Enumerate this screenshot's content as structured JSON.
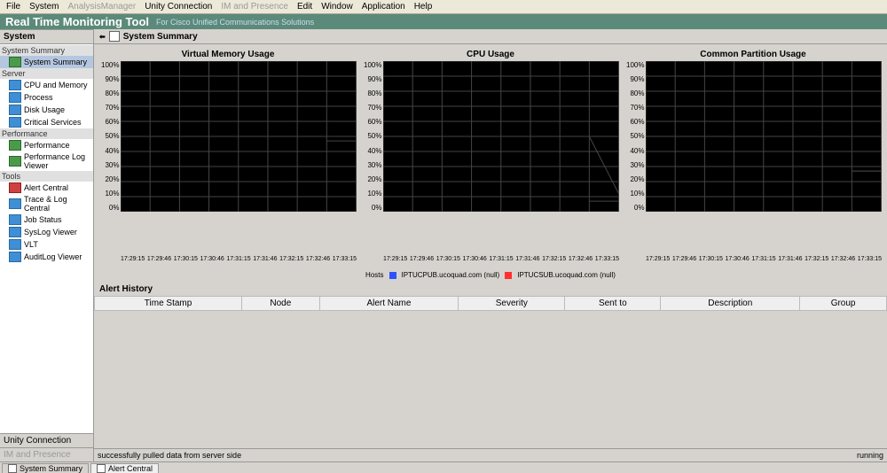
{
  "menu": {
    "items": [
      "File",
      "System",
      "AnalysisManager",
      "Unity Connection",
      "IM and Presence",
      "Edit",
      "Window",
      "Application",
      "Help"
    ],
    "dim": [
      2,
      4
    ]
  },
  "title": {
    "main": "Real Time Monitoring Tool",
    "sub": "For Cisco Unified Communications Solutions"
  },
  "sidebar": {
    "head": "System",
    "cats": [
      {
        "label": "System Summary",
        "items": [
          {
            "label": "System Summary",
            "sel": true,
            "ic": "g"
          }
        ]
      },
      {
        "label": "Server",
        "items": [
          {
            "label": "CPU and Memory",
            "ic": "b"
          },
          {
            "label": "Process",
            "ic": "b"
          },
          {
            "label": "Disk Usage",
            "ic": "b"
          },
          {
            "label": "Critical Services",
            "ic": "b"
          }
        ]
      },
      {
        "label": "Performance",
        "items": [
          {
            "label": "Performance",
            "ic": "g"
          },
          {
            "label": "Performance Log Viewer",
            "ic": "g"
          }
        ]
      },
      {
        "label": "Tools",
        "items": [
          {
            "label": "Alert Central",
            "ic": "r"
          },
          {
            "label": "Trace & Log Central",
            "ic": "b"
          },
          {
            "label": "Job Status",
            "ic": "b"
          },
          {
            "label": "SysLog Viewer",
            "ic": "b"
          },
          {
            "label": "VLT",
            "ic": "b"
          },
          {
            "label": "AuditLog Viewer",
            "ic": "b"
          }
        ]
      }
    ],
    "foot1": "Unity Connection",
    "foot2": "IM and Presence"
  },
  "panel_title": "System Summary",
  "yticks": [
    "100%",
    "90%",
    "80%",
    "70%",
    "60%",
    "50%",
    "40%",
    "30%",
    "20%",
    "10%",
    "0%"
  ],
  "xticks": [
    "17:29:15",
    "17:29:46",
    "17:30:15",
    "17:30:46",
    "17:31:15",
    "17:31:46",
    "17:32:15",
    "17:32:46",
    "17:33:15"
  ],
  "legend": {
    "label": "Hosts",
    "items": [
      {
        "name": "IPTUCPUB.ucoquad.com (null)",
        "color": "#3050ff"
      },
      {
        "name": "IPTUCSUB.ucoquad.com (null)",
        "color": "#ff3030"
      }
    ]
  },
  "alert": {
    "title": "Alert History",
    "cols": [
      "Time Stamp",
      "Node",
      "Alert Name",
      "Severity",
      "Sent to",
      "Description",
      "Group"
    ]
  },
  "status": {
    "left": "successfully pulled data from server side",
    "right": "running"
  },
  "tabs": [
    {
      "label": "System Summary",
      "sel": true
    },
    {
      "label": "Alert Central",
      "sel": false
    }
  ],
  "chart_data": [
    {
      "type": "line",
      "title": "Virtual Memory Usage",
      "ylim": [
        0,
        100
      ],
      "ylabel": "%",
      "x": [
        "17:29:15",
        "17:29:46",
        "17:30:15",
        "17:30:46",
        "17:31:15",
        "17:31:46",
        "17:32:15",
        "17:32:46",
        "17:33:15"
      ],
      "series": [
        {
          "name": "IPTUCPUB",
          "color": "#3050ff",
          "values": [
            null,
            null,
            null,
            null,
            null,
            null,
            null,
            50,
            50
          ]
        },
        {
          "name": "IPTUCSUB",
          "color": "#ff3030",
          "values": [
            null,
            null,
            null,
            null,
            null,
            null,
            null,
            47,
            47
          ]
        }
      ]
    },
    {
      "type": "line",
      "title": "CPU Usage",
      "ylim": [
        0,
        100
      ],
      "ylabel": "%",
      "x": [
        "17:29:15",
        "17:29:46",
        "17:30:15",
        "17:30:46",
        "17:31:15",
        "17:31:46",
        "17:32:15",
        "17:32:46",
        "17:33:15"
      ],
      "series": [
        {
          "name": "IPTUCPUB",
          "color": "#3050ff",
          "values": [
            null,
            null,
            null,
            null,
            null,
            null,
            null,
            50,
            12
          ]
        },
        {
          "name": "IPTUCSUB",
          "color": "#ff3030",
          "values": [
            null,
            null,
            null,
            null,
            null,
            null,
            null,
            7,
            7
          ]
        }
      ]
    },
    {
      "type": "line",
      "title": "Common Partition Usage",
      "ylim": [
        0,
        100
      ],
      "ylabel": "%",
      "x": [
        "17:29:15",
        "17:29:46",
        "17:30:15",
        "17:30:46",
        "17:31:15",
        "17:31:46",
        "17:32:15",
        "17:32:46",
        "17:33:15"
      ],
      "series": [
        {
          "name": "IPTUCPUB",
          "color": "#3050ff",
          "values": [
            null,
            null,
            null,
            null,
            null,
            null,
            null,
            27,
            27
          ]
        },
        {
          "name": "IPTUCSUB",
          "color": "#ff3030",
          "values": [
            null,
            null,
            null,
            null,
            null,
            null,
            null,
            27,
            27
          ]
        }
      ]
    }
  ]
}
